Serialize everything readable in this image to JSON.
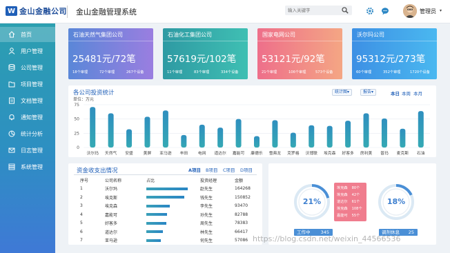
{
  "header": {
    "logo_mark": "W",
    "logo_text": "金山金融公司",
    "app_title": "金山金融管理系统",
    "search_placeholder": "输入关键字",
    "user_name": "管理员",
    "caret": "▾"
  },
  "sidebar": {
    "items": [
      {
        "label": "首页",
        "icon": "home-icon",
        "active": true
      },
      {
        "label": "用户管理",
        "icon": "user-icon"
      },
      {
        "label": "公司管理",
        "icon": "database-icon"
      },
      {
        "label": "项目管理",
        "icon": "folder-icon"
      },
      {
        "label": "文档管理",
        "icon": "document-icon"
      },
      {
        "label": "通知管理",
        "icon": "bell-icon"
      },
      {
        "label": "统计分析",
        "icon": "pie-chart-icon"
      },
      {
        "label": "日志管理",
        "icon": "mail-icon"
      },
      {
        "label": "系统管理",
        "icon": "server-icon"
      }
    ]
  },
  "cards": [
    {
      "title": "石油天然气集团公司",
      "value": "25481元/72笔",
      "stats": [
        "18个审理",
        "72个审理",
        "267个设备"
      ],
      "colors": [
        "#5a87d8",
        "#9a7ee0"
      ]
    },
    {
      "title": "石油化工集团公司",
      "value": "57619元/102笔",
      "stats": [
        "11个审理",
        "83个审理",
        "334个设备"
      ],
      "colors": [
        "#2e9aa3",
        "#3fbfb3"
      ]
    },
    {
      "title": "国家电网公司",
      "value": "53121元/92笔",
      "stats": [
        "21个审理",
        "106个审理",
        "573个设备"
      ],
      "colors": [
        "#ee6f8a",
        "#f4a684"
      ]
    },
    {
      "title": "沃尔玛公司",
      "value": "95312元/273笔",
      "stats": [
        "60个审理",
        "352个审理",
        "1720个设备"
      ],
      "colors": [
        "#3d90e4",
        "#4ab8f0"
      ]
    }
  ],
  "chart_panel": {
    "title": "各公司投资统计",
    "unit": "单位：万元",
    "btn_stats": "统计图▾",
    "btn_report": "报告▾",
    "links": [
      {
        "label": "本日",
        "active": true
      },
      {
        "label": "本周"
      },
      {
        "label": "本月"
      }
    ]
  },
  "chart_data": {
    "type": "bar",
    "title": "各公司投资统计",
    "ylabel": "单位：万元",
    "ylim": [
      0,
      75
    ],
    "yticks": [
      "75",
      "50",
      "25",
      "0"
    ],
    "categories": [
      "沃尔玛",
      "天然气",
      "安盛",
      "美屏",
      "亚马逊",
      "丰田",
      "电网",
      "道达尔",
      "嘉能可",
      "康德乐",
      "雪弗龙",
      "克罗格",
      "沃博联",
      "埃克森",
      "好客多",
      "房利美",
      "普玛",
      "麦克斯",
      "石油"
    ],
    "values": [
      71,
      60,
      32,
      54,
      65,
      22,
      40,
      35,
      50,
      20,
      48,
      26,
      39,
      38,
      47,
      60,
      51,
      33,
      64
    ]
  },
  "table_panel": {
    "title": "资金收支出情况",
    "tabs": [
      {
        "label": "A项目",
        "active": true
      },
      {
        "label": "B项目"
      },
      {
        "label": "C项目"
      },
      {
        "label": "D项目"
      }
    ],
    "headers": [
      "序号",
      "公司名称",
      "占比",
      "投资经理",
      "金额"
    ],
    "rows": [
      {
        "idx": "1",
        "name": "沃尔玛",
        "share": 1.0,
        "manager": "赵先生",
        "amount": "164268"
      },
      {
        "idx": "2",
        "name": "埃克斯",
        "share": 0.92,
        "manager": "钱先生",
        "amount": "150852"
      },
      {
        "idx": "3",
        "name": "埃克森",
        "share": 0.57,
        "manager": "李先生",
        "amount": "93470"
      },
      {
        "idx": "4",
        "name": "嘉能可",
        "share": 0.5,
        "manager": "孙先生",
        "amount": "82788"
      },
      {
        "idx": "5",
        "name": "好客多",
        "share": 0.48,
        "manager": "周先生",
        "amount": "78383"
      },
      {
        "idx": "6",
        "name": "道达尔",
        "share": 0.4,
        "manager": "林先生",
        "amount": "66417"
      },
      {
        "idx": "7",
        "name": "亚马逊",
        "share": 0.35,
        "manager": "何先生",
        "amount": "57086"
      }
    ]
  },
  "gauges": {
    "left": {
      "percent": 21,
      "label": "21%",
      "caption": "工作中",
      "count": "345"
    },
    "right": {
      "percent": 18,
      "label": "18%",
      "caption": "调剂休息",
      "count": "25"
    },
    "legend": [
      {
        "name": "埃克森",
        "value": "80个"
      },
      {
        "name": "埃克森",
        "value": "42个"
      },
      {
        "name": "道达尔",
        "value": "61个"
      },
      {
        "name": "埃克森",
        "value": "108个"
      },
      {
        "name": "嘉能可",
        "value": "55个"
      }
    ]
  },
  "watermark": "https://blog.csdn.net/weixin_44566536"
}
